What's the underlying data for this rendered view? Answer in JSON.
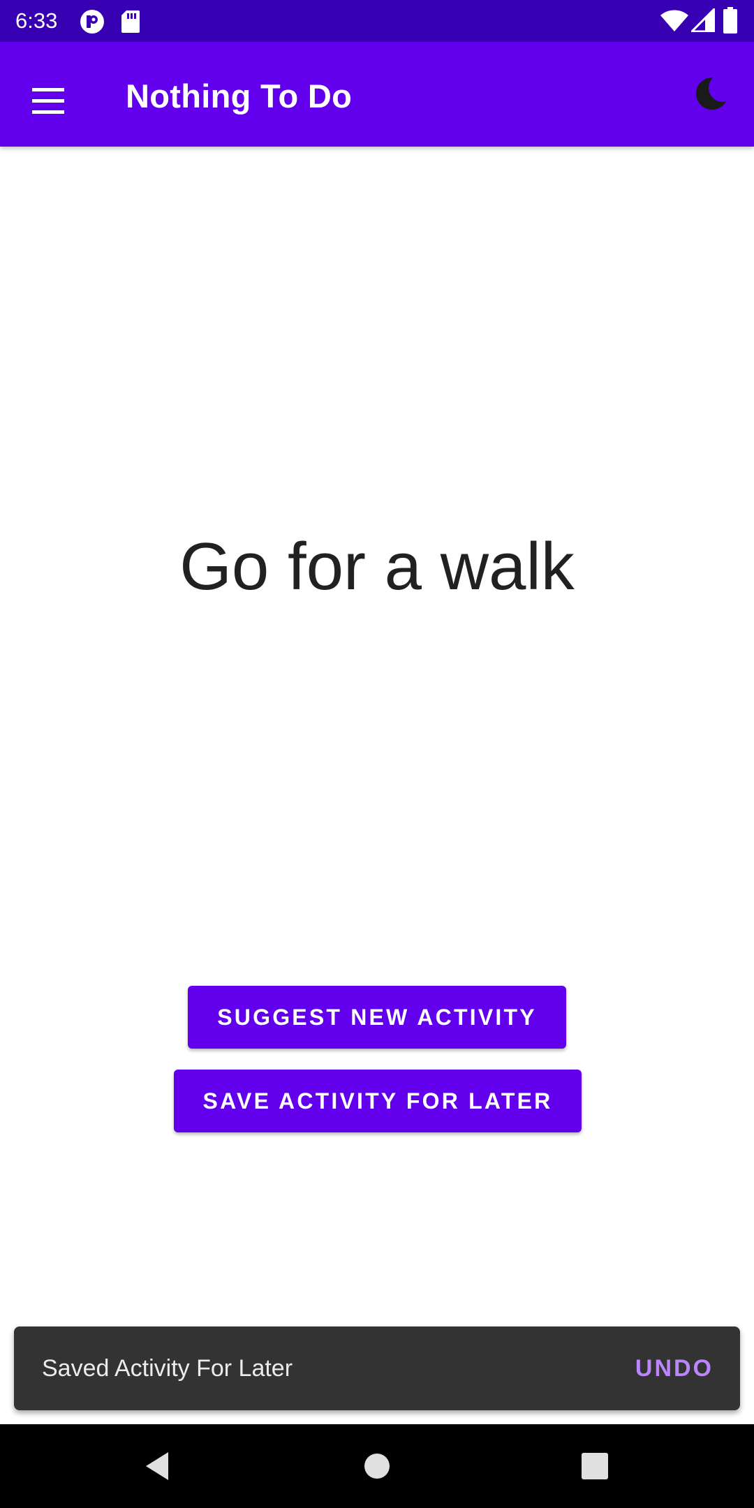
{
  "status_bar": {
    "time": "6:33",
    "left_icons": [
      "app-notification-icon",
      "sd-card-icon"
    ],
    "right_icons": [
      "wifi-icon",
      "cell-signal-icon",
      "battery-icon"
    ]
  },
  "app_bar": {
    "title": "Nothing To Do",
    "menu_icon": "hamburger-menu-icon",
    "theme_icon": "moon-icon",
    "color": "#6200ee"
  },
  "main": {
    "activity": "Go for a walk",
    "suggest_button": "SUGGEST NEW ACTIVITY",
    "save_button": "SAVE ACTIVITY FOR LATER"
  },
  "snackbar": {
    "message": "Saved Activity For Later",
    "action": "UNDO",
    "action_color": "#bb86fc"
  },
  "nav_bar": {
    "buttons": [
      "back-icon",
      "home-icon",
      "recents-icon"
    ]
  }
}
